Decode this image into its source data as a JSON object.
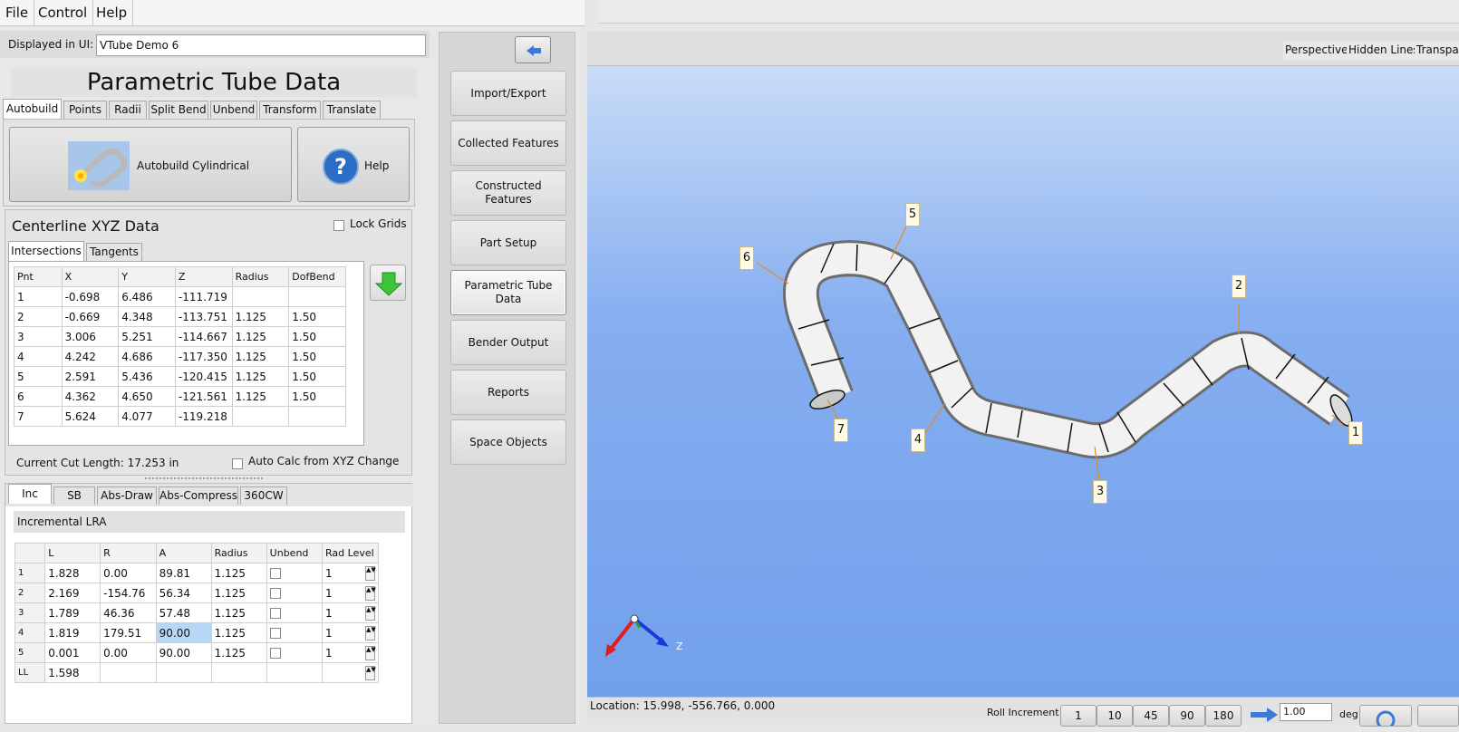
{
  "menu": [
    "File",
    "Control",
    "Help"
  ],
  "displayed_label": "Displayed in UI:",
  "displayed_value": "VTube Demo 6",
  "panel_title": "Parametric Tube Data",
  "top_tabs": [
    "Autobuild",
    "Points",
    "Radii",
    "Split Bend",
    "Unbend",
    "Transform",
    "Translate"
  ],
  "autobuild_button": "Autobuild Cylindrical",
  "help_button": "Help",
  "centerline": {
    "title": "Centerline XYZ Data",
    "lock_grids": "Lock Grids",
    "tabs": [
      "Intersections",
      "Tangents"
    ],
    "columns": [
      "Pnt",
      "X",
      "Y",
      "Z",
      "Radius",
      "DofBend"
    ],
    "rows": [
      [
        "1",
        "-0.698",
        "6.486",
        "-111.719",
        "",
        ""
      ],
      [
        "2",
        "-0.669",
        "4.348",
        "-113.751",
        "1.125",
        "1.50"
      ],
      [
        "3",
        "3.006",
        "5.251",
        "-114.667",
        "1.125",
        "1.50"
      ],
      [
        "4",
        "4.242",
        "4.686",
        "-117.350",
        "1.125",
        "1.50"
      ],
      [
        "5",
        "2.591",
        "5.436",
        "-120.415",
        "1.125",
        "1.50"
      ],
      [
        "6",
        "4.362",
        "4.650",
        "-121.561",
        "1.125",
        "1.50"
      ],
      [
        "7",
        "5.624",
        "4.077",
        "-119.218",
        "",
        ""
      ]
    ],
    "cut_length": "Current Cut Length:  17.253 in",
    "auto_calc": "Auto Calc from XYZ Change"
  },
  "lra": {
    "tabs": [
      "Inc",
      "SB",
      "Abs-Draw",
      "Abs-Compress",
      "360CW"
    ],
    "title": "Incremental LRA",
    "columns": [
      "",
      "L",
      "R",
      "A",
      "Radius",
      "Unbend",
      "Rad Level"
    ],
    "rows": [
      [
        "1",
        "1.828",
        "0.00",
        "89.81",
        "1.125",
        "1"
      ],
      [
        "2",
        "2.169",
        "-154.76",
        "56.34",
        "1.125",
        "1"
      ],
      [
        "3",
        "1.789",
        "46.36",
        "57.48",
        "1.125",
        "1"
      ],
      [
        "4",
        "1.819",
        "179.51",
        "90.00",
        "1.125",
        "1"
      ],
      [
        "5",
        "0.001",
        "0.00",
        "90.00",
        "1.125",
        "1"
      ]
    ],
    "ll_label": "LL",
    "ll_value": "1.598"
  },
  "nav": [
    "Import/Export",
    "Collected Features",
    "Constructed Features",
    "Part Setup",
    "Parametric Tube Data",
    "Bender Output",
    "Reports",
    "Space Objects"
  ],
  "nav_active": "Parametric Tube Data",
  "view_buttons": [
    "Perspective",
    "Hidden Lines",
    "Transpa"
  ],
  "point_labels": [
    "1",
    "2",
    "3",
    "4",
    "5",
    "6",
    "7"
  ],
  "axis_label": "Z",
  "status": {
    "location": "Location: 15.998, -556.766, 0.000",
    "roll_increment": "Roll Increment",
    "increments": [
      "1",
      "10",
      "45",
      "90",
      "180"
    ],
    "degree_value": "1.00",
    "deg": "deg"
  },
  "colors": {
    "viewport_top": "#c9dcf7",
    "viewport_bottom": "#72a0ec",
    "highlight_cell": "#b7d7f7"
  }
}
